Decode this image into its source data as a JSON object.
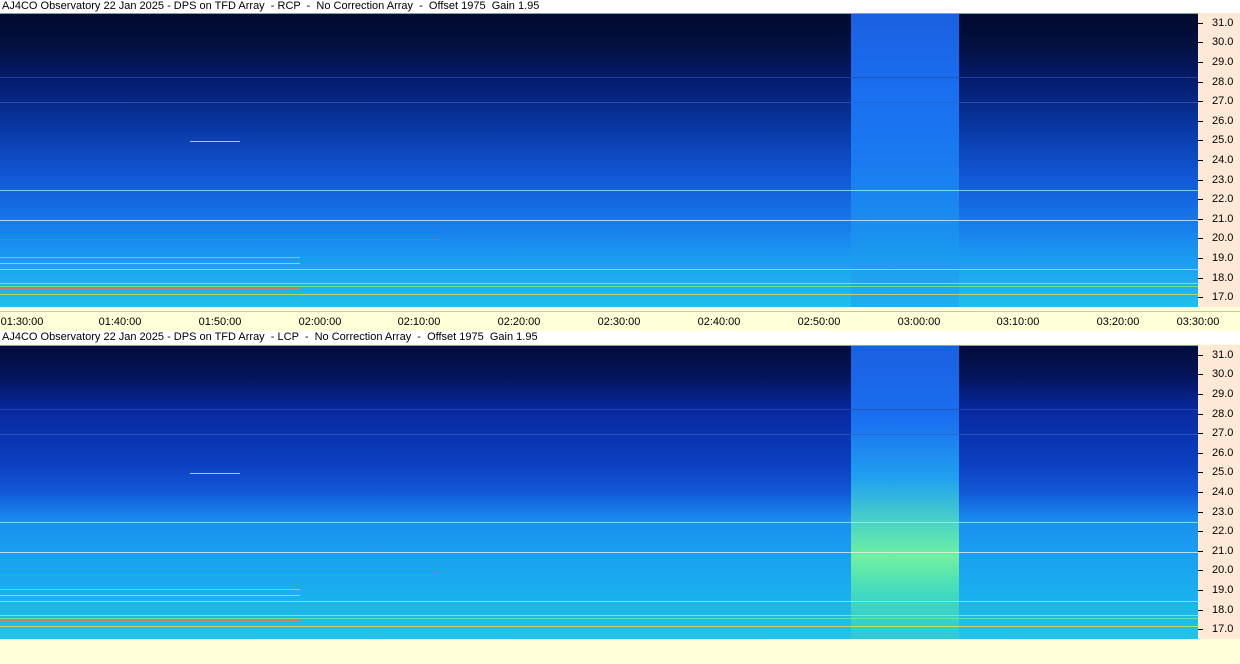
{
  "chart_data": [
    {
      "type": "heatmap",
      "title": "AJ4CO Observatory 22 Jan 2025 - DPS on TFD Array  - RCP  -  No Correction Array  -  Offset 1975  Gain 1.95",
      "polarization": "RCP",
      "x_ticks": [
        "01:30:00",
        "01:40:00",
        "01:50:00",
        "02:00:00",
        "02:10:00",
        "02:20:00",
        "02:30:00",
        "02:40:00",
        "02:50:00",
        "03:00:00",
        "03:10:00",
        "03:20:00",
        "03:30:00"
      ],
      "y_ticks": [
        "31.0",
        "30.0",
        "29.0",
        "28.0",
        "27.0",
        "26.0",
        "25.0",
        "24.0",
        "23.0",
        "22.0",
        "21.0",
        "20.0",
        "19.0",
        "18.0",
        "17.0"
      ],
      "xlim": [
        "01:30:00",
        "03:30:00"
      ],
      "ylim": [
        16.5,
        31.5
      ],
      "bright_band": {
        "start": "02:55:30",
        "end": "03:06:10"
      },
      "colormap": [
        "#020a2e",
        "#0a3aa8",
        "#1a8cf0",
        "#20c0e8",
        "#7ef07a",
        "#f0e040",
        "#ff6040"
      ]
    },
    {
      "type": "heatmap",
      "title": "AJ4CO Observatory 22 Jan 2025 - DPS on TFD Array  - LCP  -  No Correction Array  -  Offset 1975  Gain 1.95",
      "polarization": "LCP",
      "x_ticks": [],
      "y_ticks": [
        "31.0",
        "30.0",
        "29.0",
        "28.0",
        "27.0",
        "26.0",
        "25.0",
        "24.0",
        "23.0",
        "22.0",
        "21.0",
        "20.0",
        "19.0",
        "18.0",
        "17.0"
      ],
      "xlim": [
        "01:30:00",
        "03:30:00"
      ],
      "ylim": [
        16.5,
        31.5
      ],
      "bright_band": {
        "start": "02:55:30",
        "end": "03:06:10"
      },
      "colormap": [
        "#020a2e",
        "#0a3aa8",
        "#1a8cf0",
        "#20c0e8",
        "#7ef07a",
        "#f0e040",
        "#ff6040"
      ]
    }
  ]
}
